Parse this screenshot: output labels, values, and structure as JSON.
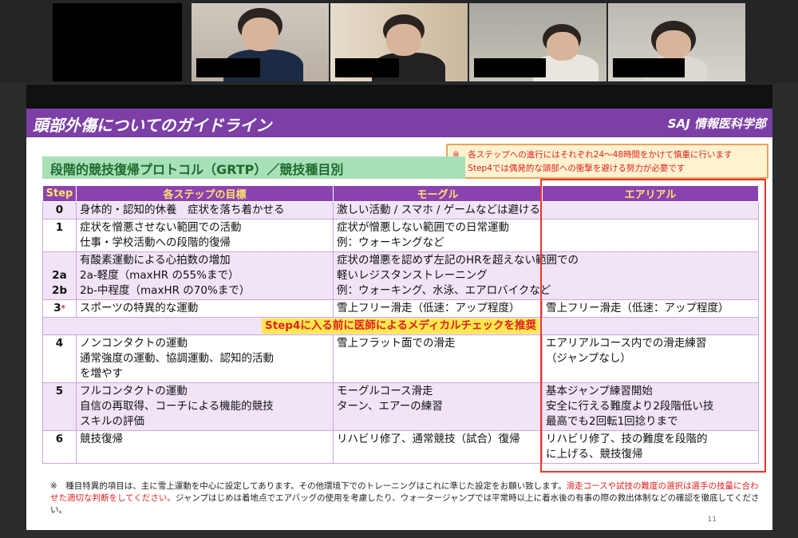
{
  "slide": {
    "title": "頭部外傷についてのガイドライン",
    "org": "SAJ 情報医科学部",
    "subtitle": "段階的競技復帰プロトコル（GRTP）／競技種目別",
    "notes": [
      "※　各ステップへの進行にはそれぞれ24～48時間をかけて慎重に行います",
      "※　Step4では偶発的な頭部への衝撃を避ける努力が必要です"
    ],
    "table": {
      "headers": [
        "Step",
        "各ステップの目標",
        "モーグル",
        "エアリアル"
      ],
      "rows": {
        "r0": {
          "step": "0",
          "goal": "身体的・認知的休養　症状を落ち着かせる",
          "mogul": "激しい活動 / スマホ / ゲームなどは避ける",
          "aerial": ""
        },
        "r1": {
          "step": "1",
          "goal1": "症状を憎悪させない範囲での活動",
          "goal2": "仕事・学校活動への段階的復帰",
          "mogul1": "症状が憎悪しない範囲での日常運動",
          "mogul2": "例：ウォーキングなど"
        },
        "r2": {
          "step_a": "2a",
          "step_b": "2b",
          "goal1": "有酸素運動による心拍数の増加",
          "goal2": "2a-軽度（maxHR の55%まで）",
          "goal3": "2b-中程度（maxHR の70%まで）",
          "mogul1": "症状の増悪を認めず左記のHRを超えない範囲での",
          "mogul2": "軽いレジスタンストレーニング",
          "mogul3": "例：ウォーキング、水泳、エアロバイクなど"
        },
        "r3": {
          "step": "3",
          "star": "*",
          "goal": "スポーツの特異的な運動",
          "mogul": "雪上フリー滑走（低速：アップ程度）",
          "aerial": "雪上フリー滑走（低速：アップ程度）"
        },
        "check": "Step4に入る前に医師によるメディカルチェックを推奨",
        "r4": {
          "step": "4",
          "goal1": "ノンコンタクトの運動",
          "goal2": "通常強度の運動、協調運動、認知的活動",
          "goal3": "を増やす",
          "mogul": "雪上フラット面での滑走",
          "aerial1": "エアリアルコース内での滑走練習",
          "aerial2": "（ジャンプなし）"
        },
        "r5": {
          "step": "5",
          "goal1": "フルコンタクトの運動",
          "goal2": "自信の再取得、コーチによる機能的競技",
          "goal3": "スキルの評価",
          "mogul1": "モーグルコース滑走",
          "mogul2": "ターン、エアーの練習",
          "aerial1": "基本ジャンプ練習開始",
          "aerial2": "安全に行える難度より2段階低い技",
          "aerial3": "最高でも2回転1回捻りまで"
        },
        "r6": {
          "step": "6",
          "goal": "競技復帰",
          "mogul": "リハビリ修了、通常競技（試合）復帰",
          "aerial1": "リハビリ修了、技の難度を段階的",
          "aerial2": "に上げる、競技復帰"
        }
      }
    },
    "footnote": {
      "part1": "※　種目特異的項目は、主に雪上運動を中心に設定してあります。その他環境下でのトレーニングはこれに準じた設定をお願い致します。",
      "part2": "滑走コースや試技の難度の選択は選手の技量に合わせた適切な判断をしてください。",
      "part3": "ジャンプはじめは着地点でエアバッグの使用を考慮したり、ウォータージャンプでは平常時以上に着水後の有事の際の救出体制などの確認を徹底してください。"
    },
    "page_number": "11"
  },
  "colors": {
    "title_bar": "#7b3fa6",
    "header_bg": "#8a43b0",
    "header_text": "#ffe36b",
    "row_alt": "#f1e4f6",
    "highlight_frame": "#e8382a",
    "subtitle_bg": "#a8e0b8"
  }
}
